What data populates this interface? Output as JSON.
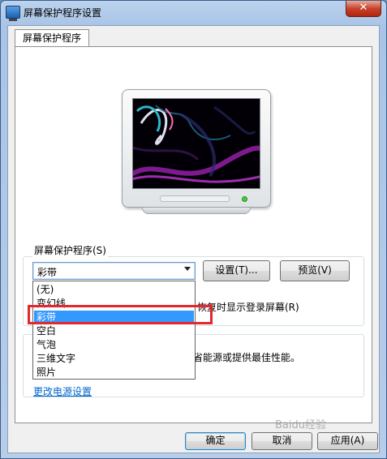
{
  "window": {
    "title": "屏幕保护程序设置",
    "close_glyph": "✕"
  },
  "tab": {
    "label": "屏幕保护程序"
  },
  "screensaver": {
    "group_label": "屏幕保护程序(S)",
    "selected": "彩带",
    "settings_label": "设置(T)...",
    "preview_label": "预览(V)",
    "resume_text": "恢复时显示登录屏幕(R)",
    "options": [
      "(无)",
      "变幻线",
      "彩带",
      "空白",
      "气泡",
      "三维文字",
      "照片"
    ],
    "selected_index": 2
  },
  "power": {
    "text": "省能源或提供最佳性能。",
    "link": "更改电源设置"
  },
  "buttons": {
    "ok": "确定",
    "cancel": "取消",
    "apply": "应用(A)"
  },
  "watermark": "Baidu经验",
  "colors": {
    "highlight_box": "#e5272b",
    "selection": "#3399ff",
    "link": "#0066cc"
  }
}
